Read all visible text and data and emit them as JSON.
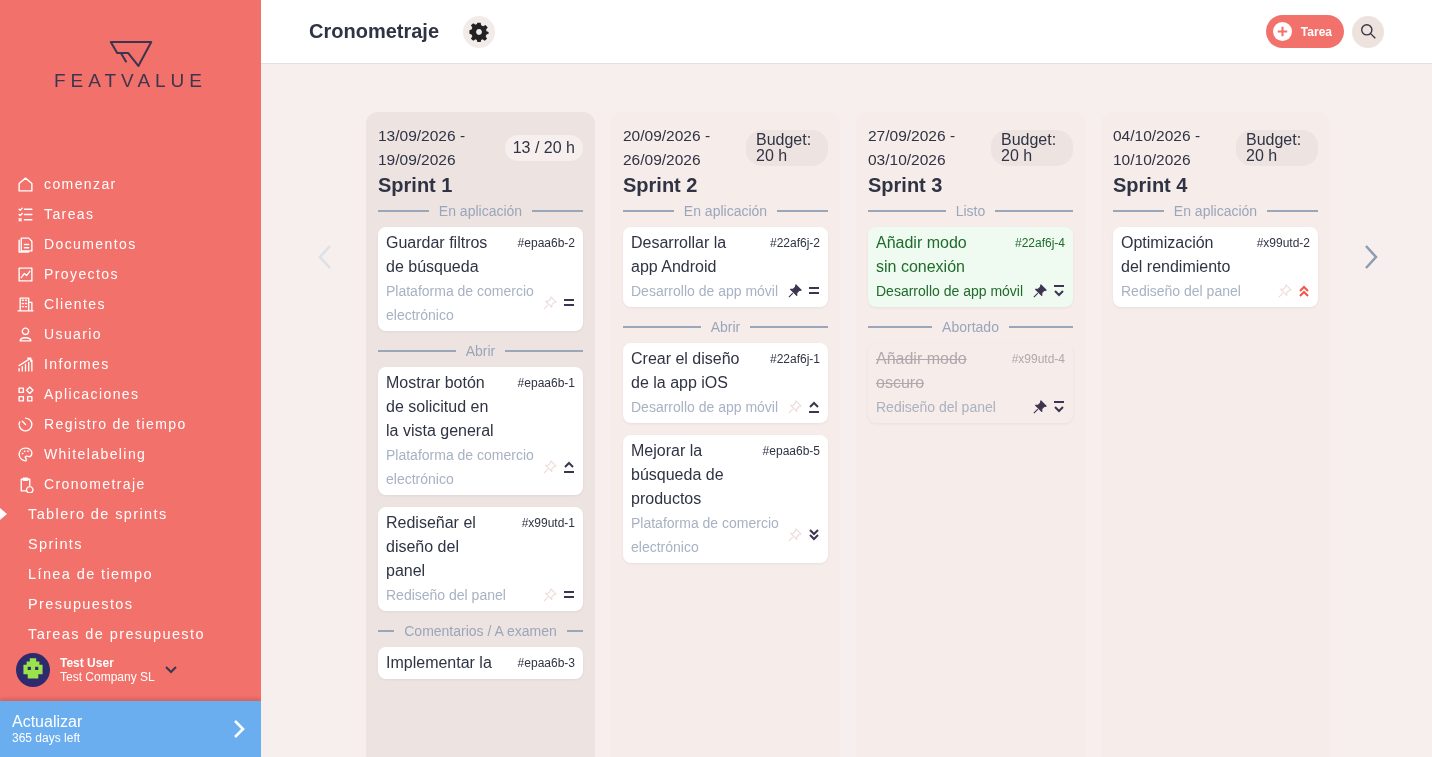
{
  "brand": {
    "name": "FEATVALUE"
  },
  "nav": [
    {
      "label": "comenzar"
    },
    {
      "label": "Tareas"
    },
    {
      "label": "Documentos"
    },
    {
      "label": "Proyectos"
    },
    {
      "label": "Clientes"
    },
    {
      "label": "Usuario"
    },
    {
      "label": "Informes"
    },
    {
      "label": "Aplicaciones"
    },
    {
      "label": "Registro de tiempo"
    },
    {
      "label": "Whitelabeling"
    },
    {
      "label": "Cronometraje",
      "children": [
        {
          "label": "Tablero de sprints",
          "selected": true
        },
        {
          "label": "Sprints",
          "selected": false
        },
        {
          "label": "Línea de tiempo",
          "selected": false
        },
        {
          "label": "Presupuestos",
          "selected": false
        },
        {
          "label": "Tareas de presupuesto",
          "selected": false
        }
      ]
    }
  ],
  "user": {
    "name": "Test User",
    "company": "Test Company SL"
  },
  "upgrade": {
    "title": "Actualizar",
    "subtitle": "365 days left"
  },
  "header": {
    "title": "Cronometraje",
    "new_button": "Tarea"
  },
  "columns": [
    {
      "dates": "13/09/2026 - 19/09/2026",
      "name": "Sprint 1",
      "budget": "13 / 20 h",
      "current": true,
      "sections": [
        {
          "label": "En aplicación",
          "cards": [
            {
              "kind": "open",
              "title": "Guardar filtros de búsqueda",
              "id": "#epaa6b-2",
              "project": "Plataforma de comercio electrónico",
              "pinned": false,
              "priority": {
                "kind": "medium"
              }
            }
          ]
        },
        {
          "label": "Abrir",
          "cards": [
            {
              "kind": "open",
              "title": "Mostrar botón de solicitud en la vista general",
              "id": "#epaa6b-1",
              "project": "Plataforma de comercio electrónico",
              "pinned": false,
              "priority": {
                "kind": "high"
              }
            },
            {
              "kind": "open",
              "title": "Rediseñar el diseño del panel",
              "id": "#x99utd-1",
              "project": "Rediseño del panel",
              "pinned": false,
              "priority": {
                "kind": "medium"
              }
            }
          ]
        },
        {
          "label": "Comentarios / A examen",
          "cards": [
            {
              "kind": "open",
              "title": "Implementar la",
              "id": "#epaa6b-3"
            }
          ]
        }
      ]
    },
    {
      "dates": "20/09/2026 - 26/09/2026",
      "name": "Sprint 2",
      "budget": "Budget: 20 h",
      "current": false,
      "sections": [
        {
          "label": "En aplicación",
          "cards": [
            {
              "kind": "open",
              "title": "Desarrollar la app Android",
              "id": "#22af6j-2",
              "project": "Desarrollo de app móvil",
              "pinned": true,
              "priority": {
                "kind": "medium"
              }
            }
          ]
        },
        {
          "label": "Abrir",
          "cards": [
            {
              "kind": "open",
              "title": "Crear el diseño de la app iOS",
              "id": "#22af6j-1",
              "project": "Desarrollo de app móvil",
              "pinned": false,
              "priority": {
                "kind": "high"
              }
            },
            {
              "kind": "open",
              "title": "Mejorar la búsqueda de productos",
              "id": "#epaa6b-5",
              "project": "Plataforma de comercio electrónico",
              "pinned": false,
              "priority": {
                "kind": "lowest"
              }
            }
          ]
        }
      ]
    },
    {
      "dates": "27/09/2026 - 03/10/2026",
      "name": "Sprint 3",
      "budget": "Budget: 20 h",
      "current": false,
      "sections": [
        {
          "label": "Listo",
          "cards": [
            {
              "kind": "done",
              "title": "Añadir modo sin conexión",
              "id": "#22af6j-4",
              "project": "Desarrollo de app móvil",
              "pinned": true,
              "priority": {
                "kind": "low"
              }
            }
          ]
        },
        {
          "label": "Abortado",
          "cards": [
            {
              "kind": "aborted",
              "title": "Añadir modo oscuro",
              "id": "#x99utd-4",
              "project": "Rediseño del panel",
              "pinned": true,
              "priority": {
                "kind": "low"
              }
            }
          ]
        }
      ]
    },
    {
      "dates": "04/10/2026 - 10/10/2026",
      "name": "Sprint 4",
      "budget": "Budget: 20 h",
      "current": false,
      "sections": [
        {
          "label": "En aplicación",
          "cards": [
            {
              "kind": "open",
              "title": "Optimización del rendimiento",
              "id": "#x99utd-2",
              "project": "Rediseño del panel",
              "pinned": false,
              "priority": {
                "kind": "highest"
              }
            }
          ]
        }
      ]
    }
  ]
}
